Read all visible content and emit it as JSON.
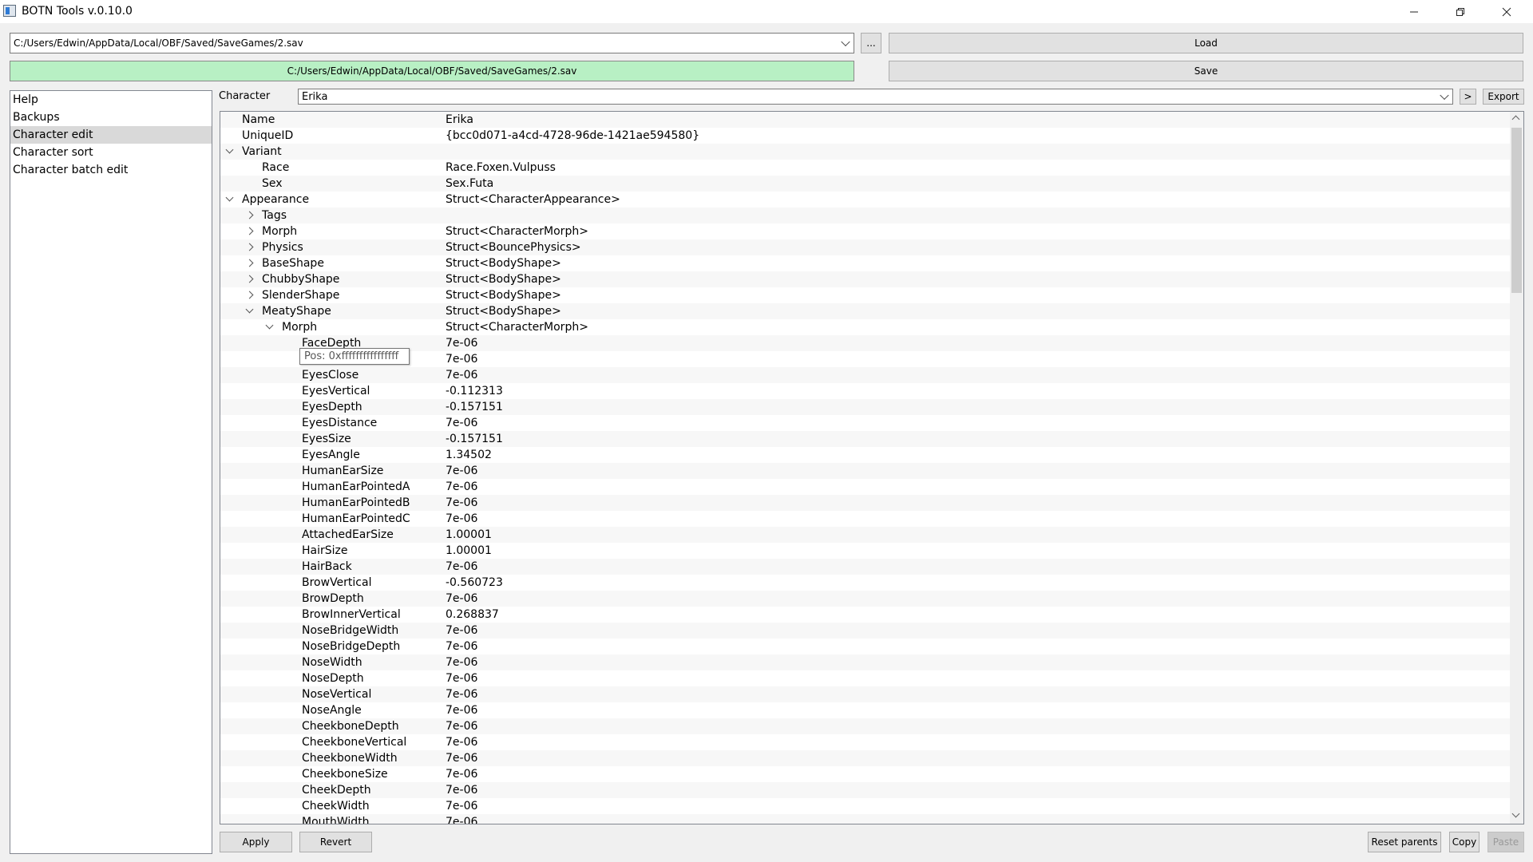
{
  "window": {
    "title": "BOTN Tools v.0.10.0",
    "minimize_icon": "minimize-icon",
    "restore_icon": "restore-icon",
    "close_icon": "close-icon"
  },
  "toolbar": {
    "path_value": "C:/Users/Edwin/AppData/Local/OBF/Saved/SaveGames/2.sav",
    "browse_label": "...",
    "load_label": "Load",
    "status_path": "C:/Users/Edwin/AppData/Local/OBF/Saved/SaveGames/2.sav",
    "save_label": "Save",
    "status_color": "#b8f0c4"
  },
  "nav": {
    "items": [
      {
        "label": "Help"
      },
      {
        "label": "Backups"
      },
      {
        "label": "Character edit"
      },
      {
        "label": "Character sort"
      },
      {
        "label": "Character batch edit"
      }
    ],
    "selected": "Character edit"
  },
  "character": {
    "label": "Character",
    "value": "Erika",
    "next_label": ">",
    "export_label": "Export"
  },
  "tree": {
    "rows": [
      {
        "key": "Name",
        "value": "Erika"
      },
      {
        "key": "UniqueID",
        "value": "{bcc0d071-a4cd-4728-96de-1421ae594580}"
      },
      {
        "key": "Variant",
        "value": ""
      },
      {
        "key": "Race",
        "value": "Race.Foxen.Vulpuss"
      },
      {
        "key": "Sex",
        "value": "Sex.Futa"
      },
      {
        "key": "Appearance",
        "value": "Struct<CharacterAppearance>"
      },
      {
        "key": "Tags",
        "value": ""
      },
      {
        "key": "Morph",
        "value": "Struct<CharacterMorph>"
      },
      {
        "key": "Physics",
        "value": "Struct<BouncePhysics>"
      },
      {
        "key": "BaseShape",
        "value": "Struct<BodyShape>"
      },
      {
        "key": "ChubbyShape",
        "value": "Struct<BodyShape>"
      },
      {
        "key": "SlenderShape",
        "value": "Struct<BodyShape>"
      },
      {
        "key": "MeatyShape",
        "value": "Struct<BodyShape>"
      },
      {
        "key": "Morph",
        "value": "Struct<CharacterMorph>"
      },
      {
        "key": "FaceDepth",
        "value": "7e-06"
      },
      {
        "key": "",
        "value": "7e-06"
      },
      {
        "key": "EyesClose",
        "value": "7e-06"
      },
      {
        "key": "EyesVertical",
        "value": "-0.112313"
      },
      {
        "key": "EyesDepth",
        "value": "-0.157151"
      },
      {
        "key": "EyesDistance",
        "value": "7e-06"
      },
      {
        "key": "EyesSize",
        "value": "-0.157151"
      },
      {
        "key": "EyesAngle",
        "value": "1.34502"
      },
      {
        "key": "HumanEarSize",
        "value": "7e-06"
      },
      {
        "key": "HumanEarPointedA",
        "value": "7e-06"
      },
      {
        "key": "HumanEarPointedB",
        "value": "7e-06"
      },
      {
        "key": "HumanEarPointedC",
        "value": "7e-06"
      },
      {
        "key": "AttachedEarSize",
        "value": "1.00001"
      },
      {
        "key": "HairSize",
        "value": "1.00001"
      },
      {
        "key": "HairBack",
        "value": "7e-06"
      },
      {
        "key": "BrowVertical",
        "value": "-0.560723"
      },
      {
        "key": "BrowDepth",
        "value": "7e-06"
      },
      {
        "key": "BrowInnerVertical",
        "value": "0.268837"
      },
      {
        "key": "NoseBridgeWidth",
        "value": "7e-06"
      },
      {
        "key": "NoseBridgeDepth",
        "value": "7e-06"
      },
      {
        "key": "NoseWidth",
        "value": "7e-06"
      },
      {
        "key": "NoseDepth",
        "value": "7e-06"
      },
      {
        "key": "NoseVertical",
        "value": "7e-06"
      },
      {
        "key": "NoseAngle",
        "value": "7e-06"
      },
      {
        "key": "CheekboneDepth",
        "value": "7e-06"
      },
      {
        "key": "CheekboneVertical",
        "value": "7e-06"
      },
      {
        "key": "CheekboneWidth",
        "value": "7e-06"
      },
      {
        "key": "CheekboneSize",
        "value": "7e-06"
      },
      {
        "key": "CheekDepth",
        "value": "7e-06"
      },
      {
        "key": "CheekWidth",
        "value": "7e-06"
      },
      {
        "key": "MouthWidth",
        "value": "7e-06"
      }
    ],
    "tooltip": "Pos: 0xffffffffffffffff"
  },
  "bottom": {
    "apply_label": "Apply",
    "revert_label": "Revert",
    "reset_parents_label": "Reset parents",
    "copy_label": "Copy",
    "paste_label": "Paste"
  }
}
